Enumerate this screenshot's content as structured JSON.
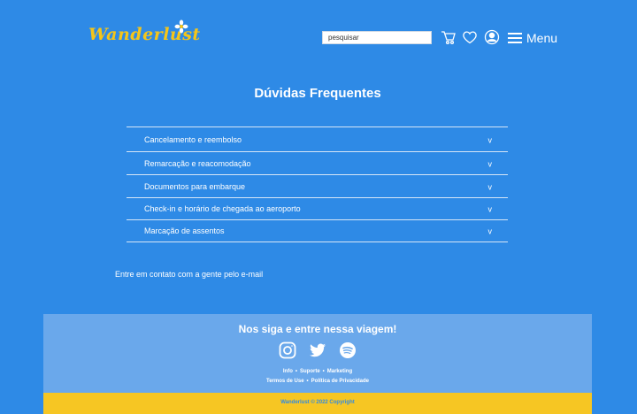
{
  "brand": {
    "name": "Wanderlust",
    "color": "#f5c518"
  },
  "header": {
    "search_placeholder": "pesquisar",
    "menu_label": "Menu",
    "icons": [
      "shopping-cart-icon",
      "heart-icon",
      "user-icon",
      "hamburger-icon"
    ]
  },
  "page": {
    "title": "Dúvidas Frequentes"
  },
  "faq": [
    {
      "label": "Cancelamento e reembolso",
      "chevron": "v"
    },
    {
      "label": "Remarcação e reacomodação",
      "chevron": "v"
    },
    {
      "label": "Documentos para embarque",
      "chevron": "v"
    },
    {
      "label": "Check-in e horário de chegada ao aeroporto",
      "chevron": "v"
    },
    {
      "label": "Marcação de assentos",
      "chevron": "v"
    }
  ],
  "contact": {
    "text": "Entre em contato com a gente pelo e-mail"
  },
  "footer": {
    "title": "Nos siga e entre nessa viagem!",
    "social_icons": [
      "instagram-icon",
      "twitter-icon",
      "spotify-icon"
    ],
    "links_row1": [
      "Info",
      "Suporte",
      "Marketing"
    ],
    "links_row2": [
      "Termos de Use",
      "Política de Privacidade"
    ],
    "separator": "•",
    "copyright": "Wanderlust © 2022 Copyright"
  },
  "colors": {
    "background": "#2e8ae6",
    "footer": "#6aa8eb",
    "copyright_bar": "#f6c623"
  }
}
